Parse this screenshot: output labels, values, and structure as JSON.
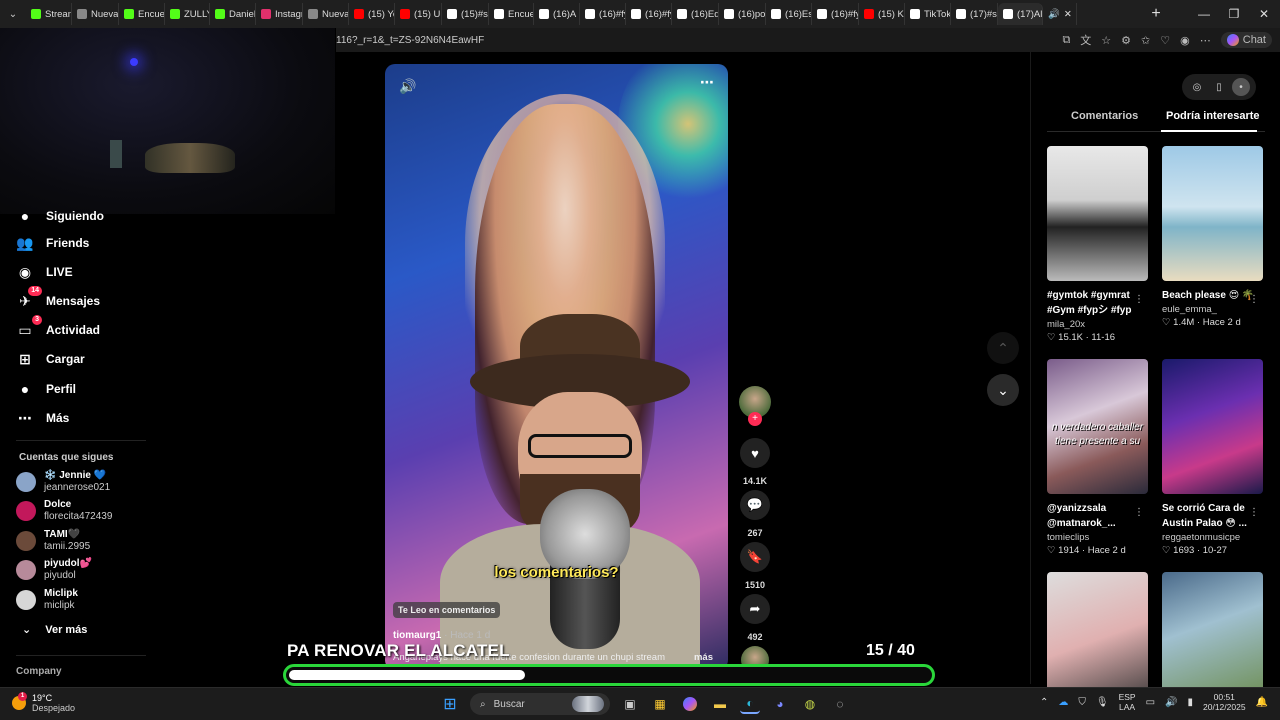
{
  "browser": {
    "tabs": [
      {
        "label": "Stream",
        "color": "#53fc18"
      },
      {
        "label": "Nueva",
        "color": "#888888"
      },
      {
        "label": "Encuen",
        "color": "#53fc18"
      },
      {
        "label": "ZULLY",
        "color": "#53fc18"
      },
      {
        "label": "Daniela",
        "color": "#53fc18"
      },
      {
        "label": "Instagr",
        "color": "#e1306c"
      },
      {
        "label": "Nueva",
        "color": "#888888"
      },
      {
        "label": "(15) Yo",
        "color": "#ff0000"
      },
      {
        "label": "(15) Ul",
        "color": "#ff0000"
      },
      {
        "label": "(15)#sc",
        "color": "#ffffff"
      },
      {
        "label": "Encuen",
        "color": "#ffffff"
      },
      {
        "label": "(16)A",
        "color": "#ffffff"
      },
      {
        "label": "(16)#fy",
        "color": "#ffffff"
      },
      {
        "label": "(16)#fy",
        "color": "#ffffff"
      },
      {
        "label": "(16)Edi",
        "color": "#ffffff"
      },
      {
        "label": "(16)po",
        "color": "#ffffff"
      },
      {
        "label": "(16)Esc",
        "color": "#ffffff"
      },
      {
        "label": "(16)#fy",
        "color": "#ffffff"
      },
      {
        "label": "(15) Ka",
        "color": "#ff0000"
      },
      {
        "label": "TikTok",
        "color": "#ffffff"
      },
      {
        "label": "(17)#s",
        "color": "#ffffff"
      },
      {
        "label": "(17)Alg",
        "color": "#ffffff"
      }
    ],
    "url": "116?_r=1&_t=ZS-92N6N4EawHF",
    "chat_label": "Chat"
  },
  "sidebar": {
    "partial_item": "Siguiendo",
    "nav": [
      {
        "label": "Friends",
        "icon": "friends-icon",
        "glyph": "👥",
        "badge": ""
      },
      {
        "label": "LIVE",
        "icon": "live-icon",
        "glyph": "◉",
        "badge": ""
      },
      {
        "label": "Mensajes",
        "icon": "messages-icon",
        "glyph": "✈",
        "badge": "14"
      },
      {
        "label": "Actividad",
        "icon": "activity-icon",
        "glyph": "▭",
        "badge": "3"
      },
      {
        "label": "Cargar",
        "icon": "upload-icon",
        "glyph": "⊞",
        "badge": ""
      },
      {
        "label": "Perfil",
        "icon": "profile-icon",
        "glyph": "●",
        "badge": ""
      },
      {
        "label": "Más",
        "icon": "more-icon",
        "glyph": "⋯",
        "badge": ""
      }
    ],
    "following_title": "Cuentas que sigues",
    "accounts": [
      {
        "name": "❄️ Jennie 💙",
        "user": "jeannerose021",
        "color": "#8aa4c8"
      },
      {
        "name": "Dolce",
        "user": "florecita472439",
        "color": "#c2185b"
      },
      {
        "name": "TAMI🖤",
        "user": "tamii.2995",
        "color": "#6b4a3a"
      },
      {
        "name": "piyudol💕",
        "user": "piyudol",
        "color": "#b78a9a"
      },
      {
        "name": "Miclipk",
        "user": "miclipk",
        "color": "#d6d6d6"
      }
    ],
    "see_more": "Ver más",
    "company": "Company"
  },
  "video": {
    "caption": "los comentarios?",
    "comment_tag": "Te Leo en comentarios",
    "author": "tiomaurg1",
    "ago": " · Hace 1 d",
    "description": "Anganeplays hace una fuerte confesion durante un chupi stream",
    "more": "más",
    "counts": {
      "likes": "14.1K",
      "comments": "267",
      "saves": "1510",
      "shares": "492"
    }
  },
  "right_panel": {
    "tabs": [
      "Comentarios",
      "Podría interesarte"
    ],
    "cards": [
      {
        "title": "#gymtok #gymrat #Gym #fypシ #fyp",
        "user": "mila_20x",
        "meta": "♡ 15.1K · 11-16",
        "overlay": ""
      },
      {
        "title": "Beach please 😍 🌴",
        "user": "eule_emma_",
        "meta": "♡ 1.4M · Hace 2 d",
        "overlay": ""
      },
      {
        "title": "@yanizzsala @matnarok_...",
        "user": "tomieclips",
        "meta": "♡ 1914 · Hace 2 d",
        "overlay": "n verdadero caballer tiene presente a su"
      },
      {
        "title": "Se corrió Cara de Austin Palao 😳 ...",
        "user": "reggaetonmusicpe",
        "meta": "♡ 1693 · 10-27",
        "overlay": ""
      },
      {
        "title": "",
        "user": "",
        "meta": "",
        "overlay": ""
      },
      {
        "title": "",
        "user": "",
        "meta": "",
        "overlay": ""
      }
    ]
  },
  "overlay": {
    "title": "PA RENOVAR EL ALCATEL",
    "counter": "15  / 40",
    "progress": 0.375
  },
  "taskbar": {
    "temp": "19°C",
    "weather": "Despejado",
    "weather_badge": "1",
    "search_placeholder": "Buscar",
    "lang1": "ESP",
    "lang2": "LAA",
    "time": "00:51",
    "date": "20/12/2025"
  }
}
